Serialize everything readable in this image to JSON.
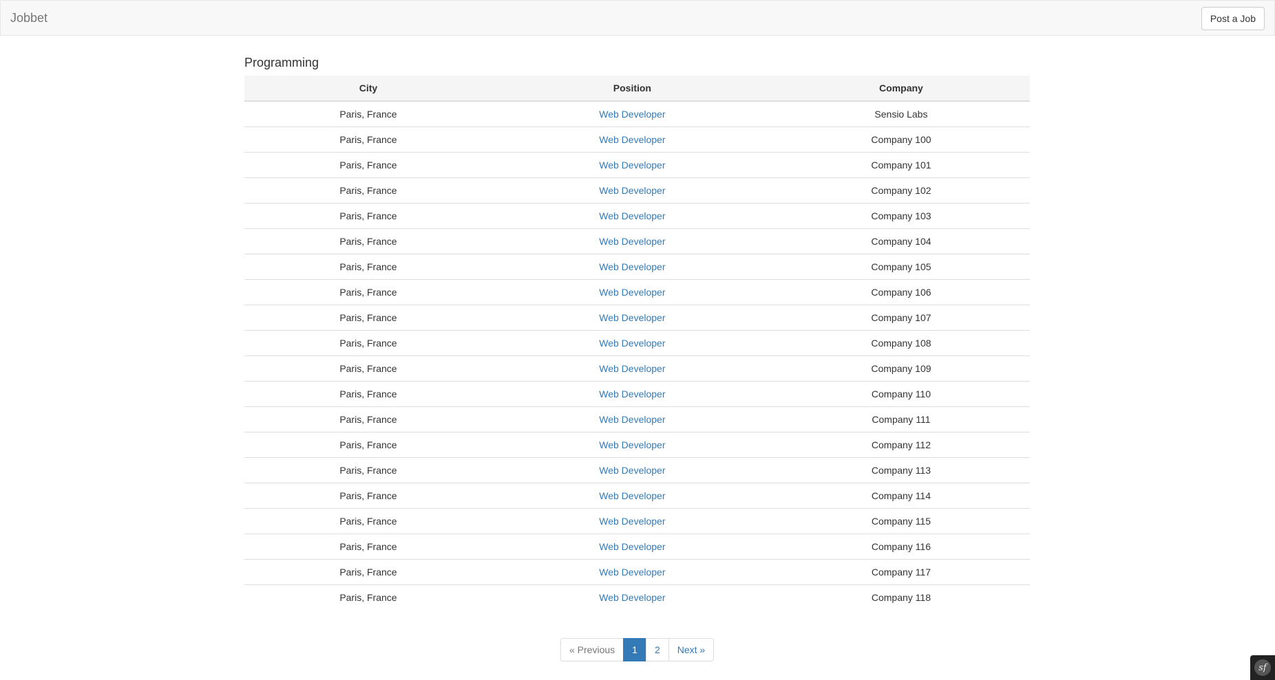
{
  "navbar": {
    "brand": "Jobbet",
    "post_job_label": "Post a Job"
  },
  "category": {
    "title": "Programming"
  },
  "table": {
    "headers": [
      "City",
      "Position",
      "Company"
    ],
    "rows": [
      {
        "city": "Paris, France",
        "position": "Web Developer",
        "company": "Sensio Labs"
      },
      {
        "city": "Paris, France",
        "position": "Web Developer",
        "company": "Company 100"
      },
      {
        "city": "Paris, France",
        "position": "Web Developer",
        "company": "Company 101"
      },
      {
        "city": "Paris, France",
        "position": "Web Developer",
        "company": "Company 102"
      },
      {
        "city": "Paris, France",
        "position": "Web Developer",
        "company": "Company 103"
      },
      {
        "city": "Paris, France",
        "position": "Web Developer",
        "company": "Company 104"
      },
      {
        "city": "Paris, France",
        "position": "Web Developer",
        "company": "Company 105"
      },
      {
        "city": "Paris, France",
        "position": "Web Developer",
        "company": "Company 106"
      },
      {
        "city": "Paris, France",
        "position": "Web Developer",
        "company": "Company 107"
      },
      {
        "city": "Paris, France",
        "position": "Web Developer",
        "company": "Company 108"
      },
      {
        "city": "Paris, France",
        "position": "Web Developer",
        "company": "Company 109"
      },
      {
        "city": "Paris, France",
        "position": "Web Developer",
        "company": "Company 110"
      },
      {
        "city": "Paris, France",
        "position": "Web Developer",
        "company": "Company 111"
      },
      {
        "city": "Paris, France",
        "position": "Web Developer",
        "company": "Company 112"
      },
      {
        "city": "Paris, France",
        "position": "Web Developer",
        "company": "Company 113"
      },
      {
        "city": "Paris, France",
        "position": "Web Developer",
        "company": "Company 114"
      },
      {
        "city": "Paris, France",
        "position": "Web Developer",
        "company": "Company 115"
      },
      {
        "city": "Paris, France",
        "position": "Web Developer",
        "company": "Company 116"
      },
      {
        "city": "Paris, France",
        "position": "Web Developer",
        "company": "Company 117"
      },
      {
        "city": "Paris, France",
        "position": "Web Developer",
        "company": "Company 118"
      }
    ]
  },
  "pagination": {
    "previous_label": "« Previous",
    "pages": [
      "1",
      "2"
    ],
    "current_page": "1",
    "next_label": "Next »"
  },
  "debug_toolbar": {
    "icon": "symfony-icon",
    "glyph": "sf"
  },
  "colors": {
    "link": "#337ab7",
    "active_page_bg": "#337ab7",
    "navbar_bg": "#f8f8f8"
  }
}
